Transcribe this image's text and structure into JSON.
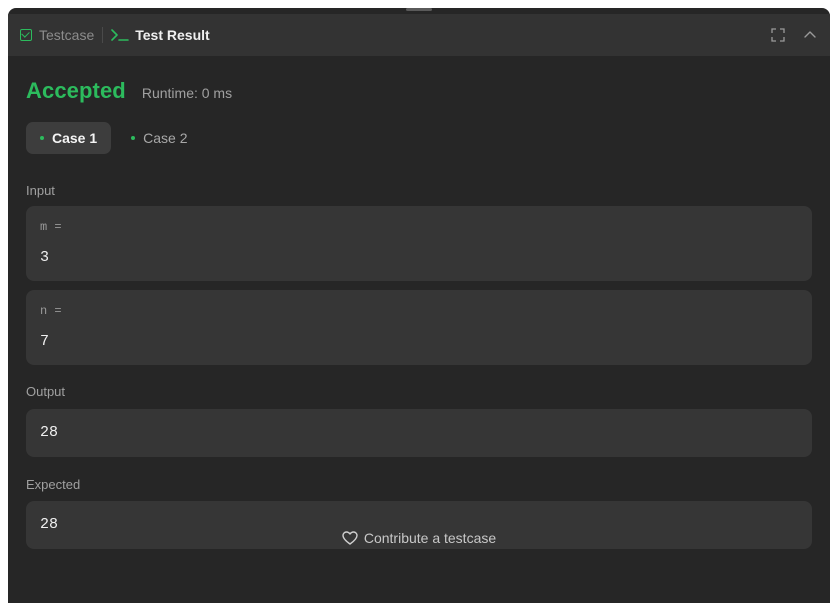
{
  "tabs": {
    "testcase_label": "Testcase",
    "result_label": "Test Result"
  },
  "icons": {
    "testcase": "checkbox-icon",
    "result": "terminal-icon",
    "expand": "fullscreen-icon",
    "collapse": "chevron-up-icon",
    "contribute": "heart-icon"
  },
  "result": {
    "status": "Accepted",
    "runtime": "Runtime: 0 ms"
  },
  "cases": [
    {
      "label": "Case 1",
      "active": true
    },
    {
      "label": "Case 2",
      "active": false
    }
  ],
  "input": {
    "label": "Input",
    "params": [
      {
        "name": "m =",
        "value": "3"
      },
      {
        "name": "n =",
        "value": "7"
      }
    ]
  },
  "output": {
    "label": "Output",
    "value": "28"
  },
  "expected": {
    "label": "Expected",
    "value": "28"
  },
  "footer": {
    "contribute_label": "Contribute a testcase"
  },
  "colors": {
    "accent": "#2cbb5d",
    "panel": "#262626",
    "field": "#363636"
  }
}
